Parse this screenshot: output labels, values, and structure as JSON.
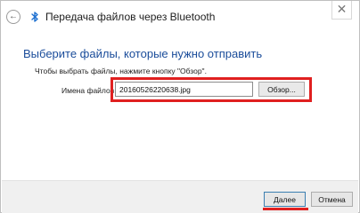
{
  "window": {
    "title": "Передача файлов через Bluetooth",
    "close_glyph": "✕"
  },
  "icons": {
    "back": "back-arrow-icon",
    "bluetooth": "bluetooth-icon",
    "close": "close-icon"
  },
  "content": {
    "heading": "Выберите файлы, которые нужно отправить",
    "instruction": "Чтобы выбрать файлы, нажмите кнопку \"Обзор\".",
    "file_label": "Имена файлов:",
    "file_value": "20160526220638.jpg",
    "browse_label": "Обзор..."
  },
  "footer": {
    "next_label": "Далее",
    "cancel_label": "Отмена"
  },
  "colors": {
    "heading": "#1a4c9a",
    "highlight": "#e02020",
    "bluetooth": "#1c6fd0",
    "footer_bg": "#f0f0f0"
  }
}
